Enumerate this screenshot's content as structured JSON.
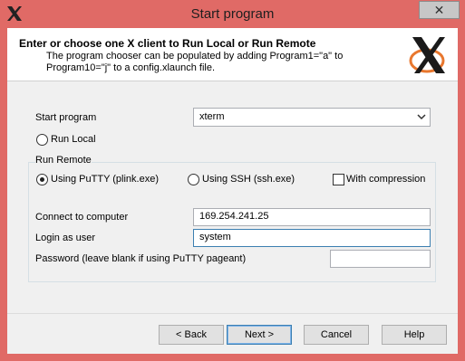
{
  "window": {
    "title": "Start program",
    "close_glyph": "✕",
    "app_icon": "x-logo-icon"
  },
  "header": {
    "title": "Enter or choose one X client to Run Local or Run Remote",
    "description": "The program chooser can be populated by adding Program1=\"a\" to Program10=\"j\" to a config.xlaunch file.",
    "logo": "x-window-system-logo"
  },
  "form": {
    "start_program_label": "Start program",
    "start_program_value": "xterm",
    "run_local_label": "Run Local",
    "run_local_checked": false,
    "run_remote_title": "Run Remote",
    "using_putty_label": "Using PuTTY (plink.exe)",
    "using_putty_checked": true,
    "using_ssh_label": "Using SSH (ssh.exe)",
    "using_ssh_checked": false,
    "compression_label": "With compression",
    "compression_checked": false,
    "connect_label": "Connect to computer",
    "connect_value": "169.254.241.25",
    "login_label": "Login as user",
    "login_value": "system",
    "password_label": "Password (leave blank if using PuTTY pageant)",
    "password_value": ""
  },
  "buttons": {
    "back": "< Back",
    "next": "Next >",
    "cancel": "Cancel",
    "help": "Help"
  },
  "colors": {
    "frame": "#e06a66",
    "accent_border": "#3c7fb1"
  }
}
